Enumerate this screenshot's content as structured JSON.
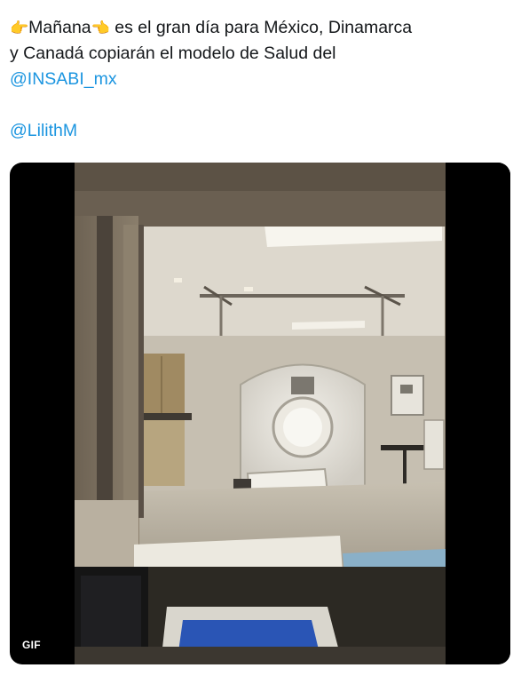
{
  "tweet": {
    "emoji_left": "👉",
    "text_word": "Mañana",
    "emoji_right": "👈",
    "line1_rest": " es el gran día para México, Dinamarca",
    "line2": "y Canadá copiarán el modelo de Salud del",
    "mention1": "@INSABI_mx",
    "mention2": "@LilithM"
  },
  "media": {
    "badge": "GIF",
    "scene": "hospital-ct-scanner-room"
  },
  "colors": {
    "link": "#1b95e0",
    "text": "#14171a",
    "media_bg": "#000000"
  }
}
